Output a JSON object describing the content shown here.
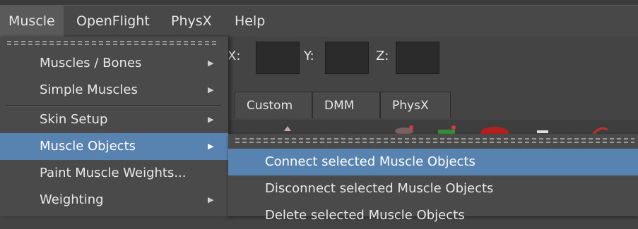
{
  "menubar": {
    "items": [
      {
        "label": "Muscle",
        "open": true
      },
      {
        "label": "OpenFlight"
      },
      {
        "label": "PhysX"
      },
      {
        "label": "Help"
      }
    ]
  },
  "toolbar": {
    "coords": [
      {
        "label": "X:"
      },
      {
        "label": "Y:"
      },
      {
        "label": "Z:"
      }
    ]
  },
  "tabs": [
    "Custom",
    "DMM",
    "PhysX"
  ],
  "muscle_menu": {
    "items": [
      {
        "label": "Muscles / Bones",
        "submenu": true
      },
      {
        "label": "Simple Muscles",
        "submenu": true
      },
      {
        "label": "Skin Setup",
        "submenu": true
      },
      {
        "label": "Muscle Objects",
        "submenu": true,
        "highlighted": true
      },
      {
        "label": "Paint Muscle Weights..."
      },
      {
        "label": "Weighting",
        "submenu": true
      }
    ]
  },
  "muscle_objects_submenu": {
    "items": [
      {
        "label": "Connect selected Muscle Objects",
        "highlighted": true
      },
      {
        "label": "Disconnect selected Muscle Objects"
      },
      {
        "label": "Delete selected Muscle Objects"
      }
    ]
  },
  "colors": {
    "menu_background": "#4a4a4a",
    "highlight": "#5882b0",
    "text": "#e8e8e8"
  }
}
